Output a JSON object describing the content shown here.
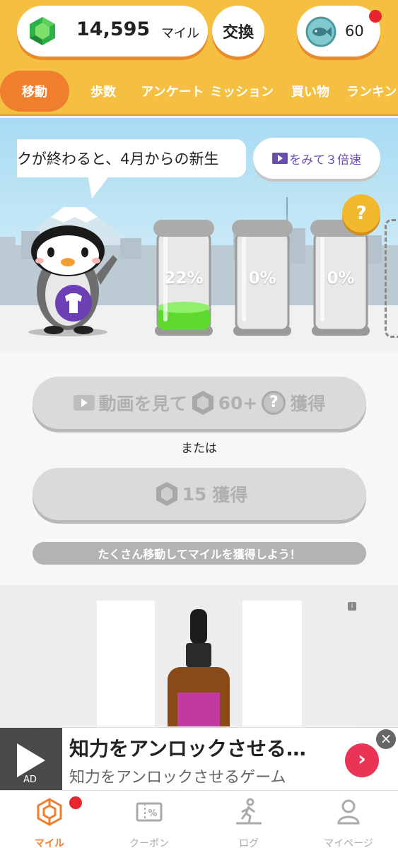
{
  "header": {
    "miles_value": "14,595",
    "miles_unit": "マイル",
    "exchange_label": "交換",
    "fish_count": "60"
  },
  "tabs": [
    {
      "label": "移動",
      "active": true
    },
    {
      "label": "歩数",
      "active": false
    },
    {
      "label": "アンケート",
      "active": false
    },
    {
      "label": "ミッション",
      "active": false
    },
    {
      "label": "買い物",
      "active": false
    },
    {
      "label": "ランキン",
      "active": false
    }
  ],
  "hero": {
    "speech_text": "クが終わると、4月からの新生",
    "speed_button_label": "をみて３倍速",
    "help_label": "?",
    "jars": [
      {
        "percent_label": "22%",
        "fill": 0.22
      },
      {
        "percent_label": "0%",
        "fill": 0
      },
      {
        "percent_label": "0%",
        "fill": 0
      }
    ]
  },
  "actions": {
    "video_button": {
      "part1": "動画を見て",
      "amount": "60",
      "plus": "+",
      "q": "?",
      "part2": "獲得"
    },
    "or_text": "または",
    "earn_button": {
      "amount": "15",
      "label": "獲得"
    },
    "hint": "たくさん移動してマイルを獲得しよう！"
  },
  "banner_ad": {
    "ad_label": "AD",
    "title": "知力をアンロックさせる…",
    "subtitle": "知力をアンロックさせるゲーム",
    "go": "›",
    "close": "×"
  },
  "bottom_nav": [
    {
      "label": "マイル",
      "active": true
    },
    {
      "label": "クーポン",
      "active": false
    },
    {
      "label": "ログ",
      "active": false
    },
    {
      "label": "マイページ",
      "active": false
    }
  ],
  "colors": {
    "header_yellow": "#f5c042",
    "accent_orange": "#ef7e2f",
    "badge_red": "#e8242c",
    "jar_fill_green": "#5fd82f"
  }
}
